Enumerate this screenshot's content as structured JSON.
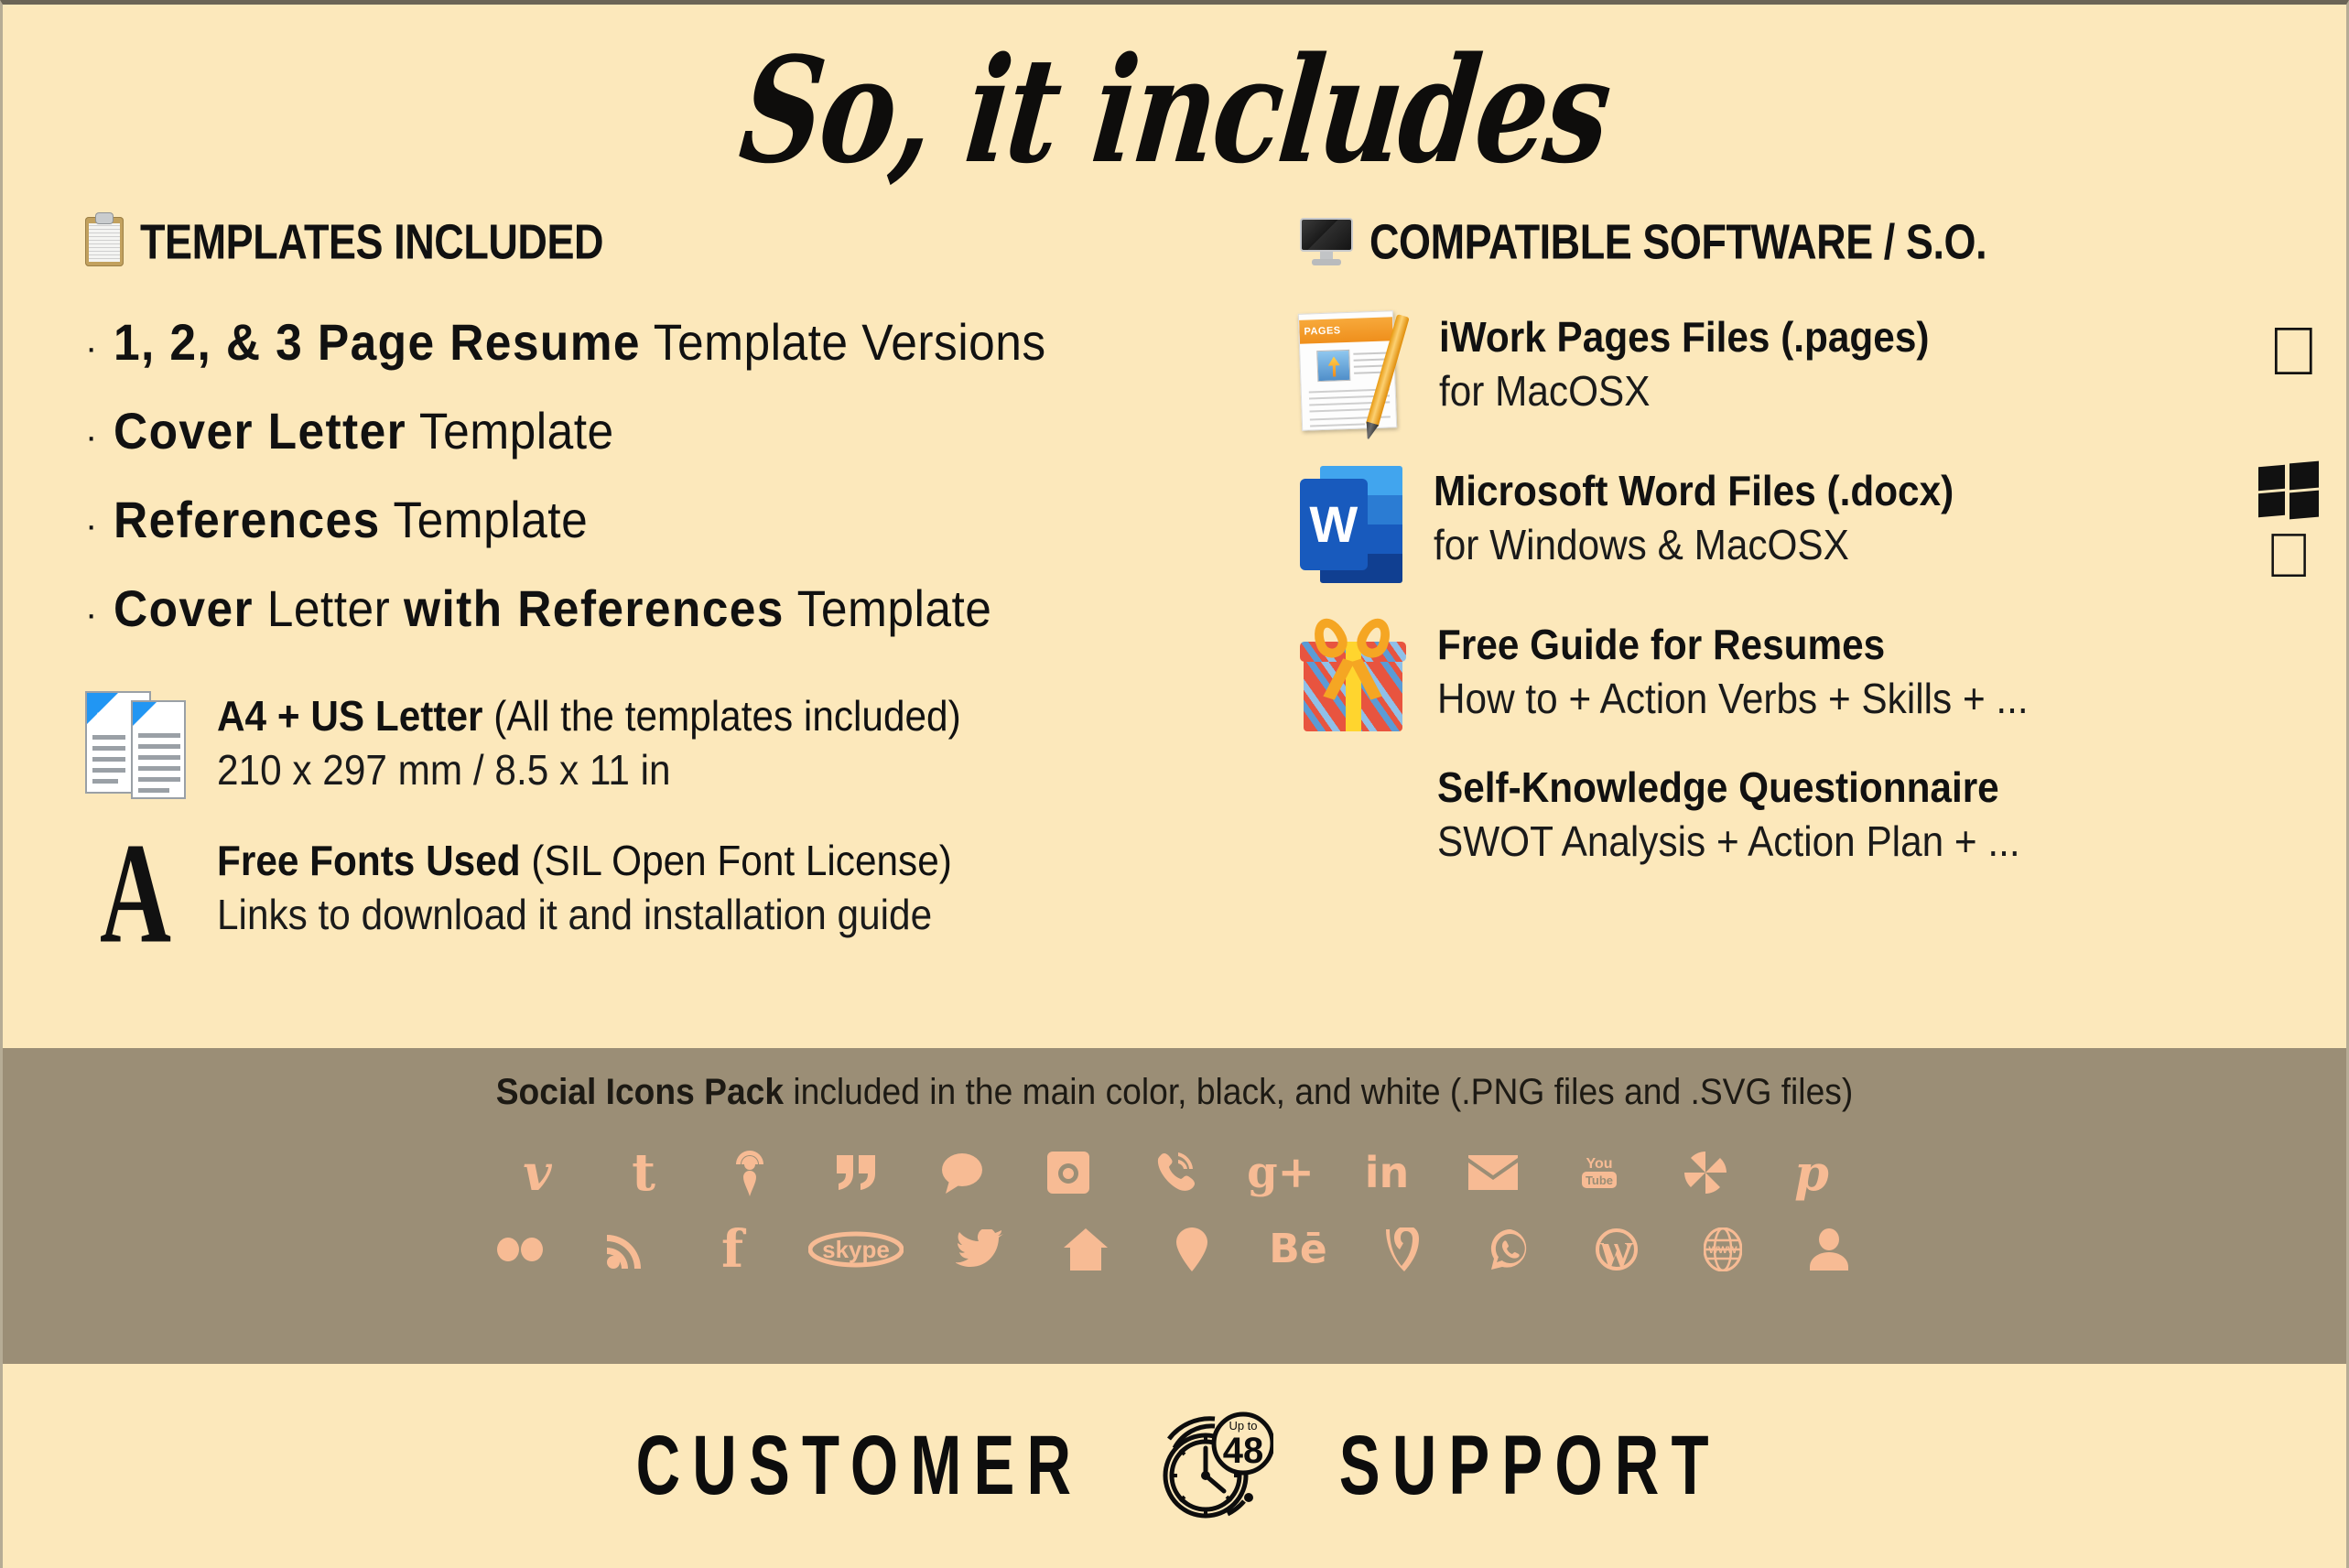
{
  "header": {
    "title": "So, it includes"
  },
  "colors": {
    "background": "#fce8bb",
    "social_band": "#9b8e76",
    "social_icon": "#f7bb94",
    "text": "#111111",
    "word_blue": "#185abd",
    "pages_orange": "#ef8f1c"
  },
  "left_column": {
    "section_icon": "clipboard-icon",
    "section_title": "TEMPLATES INCLUDED",
    "bullets": [
      {
        "bold": "1, 2, & 3 Page Resume",
        "rest": " Template Versions"
      },
      {
        "bold": "Cover Letter",
        "rest": " Template"
      },
      {
        "bold": "References",
        "rest": " Template"
      },
      {
        "bold": "Cover",
        "mid": " Letter ",
        "bold2": "with References",
        "rest": " Template"
      }
    ],
    "features": [
      {
        "icon": "a4-pages-icon",
        "line1_bold": "A4 + US Letter",
        "line1_rest": " (All the templates included)",
        "line2": "210 x 297 mm / 8.5 x 11 in"
      },
      {
        "icon": "serif-a-icon",
        "icon_glyph": "A",
        "line1_bold": "Free Fonts Used",
        "line1_rest": " (SIL Open Font License)",
        "line2": "Links to download it and installation guide"
      }
    ]
  },
  "right_column": {
    "section_icon": "monitor-icon",
    "section_title": "COMPATIBLE SOFTWARE / S.O.",
    "features": [
      {
        "icon": "pages-app-icon",
        "line1": "iWork Pages Files (.pages)",
        "line2": "for MacOSX",
        "os_marks": [
          "apple-logo-icon"
        ]
      },
      {
        "icon": "word-app-icon",
        "line1": "Microsoft Word Files (.docx)",
        "line2": "for Windows & MacOSX",
        "os_marks": [
          "windows-logo-icon",
          "apple-logo-icon"
        ]
      },
      {
        "icon": "gift-icon",
        "line1": "Free Guide for Resumes",
        "line2": "How to + Action Verbs + Skills + ...",
        "os_marks": []
      },
      {
        "icon": "",
        "line1": "Self-Knowledge Questionnaire",
        "line2": "SWOT Analysis + Action Plan + ...",
        "os_marks": []
      }
    ]
  },
  "social": {
    "caption_bold": "Social Icons Pack",
    "caption_rest": " included in the main color, black, and white (.PNG files and .SVG files)",
    "row1": [
      {
        "name": "vimeo-icon",
        "glyph": "v"
      },
      {
        "name": "tumblr-icon",
        "glyph": "t"
      },
      {
        "name": "podcast-icon",
        "glyph": ""
      },
      {
        "name": "quote-icon",
        "glyph": "”"
      },
      {
        "name": "chat-bubble-icon",
        "glyph": ""
      },
      {
        "name": "instagram-icon",
        "glyph": ""
      },
      {
        "name": "viber-phone-icon",
        "glyph": ""
      },
      {
        "name": "google-plus-icon",
        "glyph": "g+"
      },
      {
        "name": "linkedin-icon",
        "glyph": "in"
      },
      {
        "name": "email-icon",
        "glyph": ""
      },
      {
        "name": "youtube-icon",
        "glyph": ""
      },
      {
        "name": "picasa-icon",
        "glyph": ""
      },
      {
        "name": "pinterest-icon",
        "glyph": "p"
      }
    ],
    "row2": [
      {
        "name": "flickr-icon",
        "glyph": ""
      },
      {
        "name": "rss-icon",
        "glyph": ""
      },
      {
        "name": "facebook-icon",
        "glyph": "f"
      },
      {
        "name": "skype-icon",
        "glyph": "skype"
      },
      {
        "name": "twitter-icon",
        "glyph": ""
      },
      {
        "name": "home-icon",
        "glyph": ""
      },
      {
        "name": "location-pin-icon",
        "glyph": ""
      },
      {
        "name": "behance-icon",
        "glyph": "Bē"
      },
      {
        "name": "vine-icon",
        "glyph": "V"
      },
      {
        "name": "whatsapp-icon",
        "glyph": ""
      },
      {
        "name": "wordpress-icon",
        "glyph": "W"
      },
      {
        "name": "www-globe-icon",
        "glyph": "www"
      },
      {
        "name": "profile-icon",
        "glyph": ""
      }
    ]
  },
  "footer": {
    "word_left": "CUSTOMER",
    "word_right": "SUPPORT",
    "clock_badge_small": "Up to",
    "clock_badge_number": "48"
  }
}
